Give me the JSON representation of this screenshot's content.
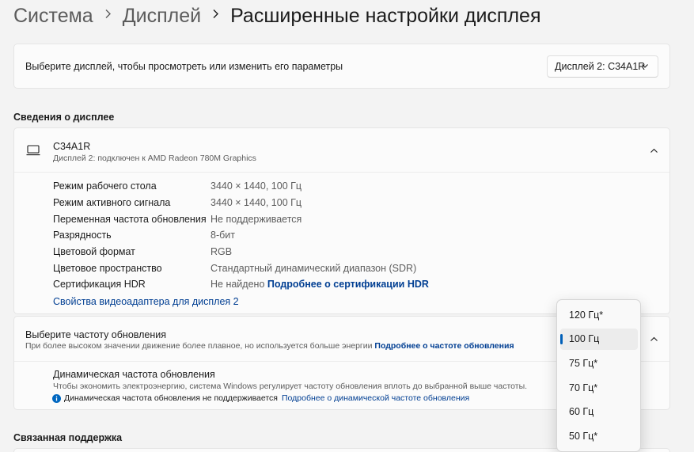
{
  "breadcrumb": {
    "items": [
      "Система",
      "Дисплей"
    ],
    "current": "Расширенные настройки дисплея"
  },
  "display_select": {
    "label": "Выберите дисплей, чтобы просмотреть или изменить его параметры",
    "value": "Дисплей 2: C34A1R"
  },
  "info_section": {
    "title": "Сведения о дисплее",
    "monitor_name": "C34A1R",
    "monitor_sub": "Дисплей 2: подключен к AMD Radeon 780M Graphics",
    "rows": [
      {
        "key": "Режим рабочего стола",
        "value": "3440 × 1440, 100 Гц"
      },
      {
        "key": "Режим активного сигнала",
        "value": "3440 × 1440, 100 Гц"
      },
      {
        "key": "Переменная частота обновления",
        "value": "Не поддерживается"
      },
      {
        "key": "Разрядность",
        "value": "8-бит"
      },
      {
        "key": "Цветовой формат",
        "value": "RGB"
      },
      {
        "key": "Цветовое пространство",
        "value": "Стандартный динамический диапазон (SDR)"
      },
      {
        "key": "Сертификация HDR",
        "value": "Не найдено",
        "link": "Подробнее о сертификации HDR"
      }
    ],
    "adapter_link": "Свойства видеоадаптера для дисплея 2"
  },
  "refresh": {
    "title": "Выберите частоту обновления",
    "sub": "При более высоком значении движение более плавное, но используется больше энергии",
    "sub_link": "Подробнее о частоте обновления",
    "dyn_title": "Динамическая частота обновления",
    "dyn_sub": "Чтобы экономить электроэнергию, система Windows регулирует частоту обновления вплоть до выбранной выше частоты.",
    "dyn_note": "Динамическая частота обновления не поддерживается",
    "dyn_link": "Подробнее о динамической частоте обновления"
  },
  "support": {
    "title": "Связанная поддержка"
  },
  "dropdown": {
    "options": [
      "120 Гц*",
      "100 Гц",
      "75 Гц*",
      "70 Гц*",
      "60 Гц",
      "50 Гц*"
    ],
    "selected": "100 Гц"
  },
  "colors": {
    "accent": "#005fb8",
    "link": "#003e92",
    "info_icon": "#0067c0"
  },
  "icons": [
    "chevron-right-icon",
    "chevron-down-icon",
    "chevron-up-icon",
    "monitor-icon",
    "info-icon"
  ]
}
